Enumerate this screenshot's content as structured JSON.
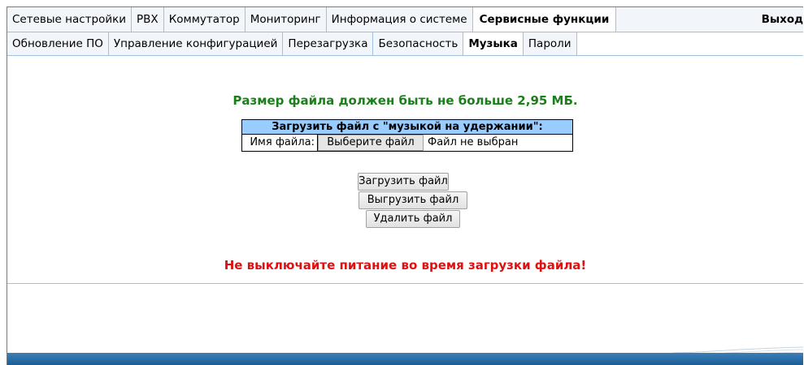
{
  "top_tabs": [
    {
      "label": "Сетевые настройки"
    },
    {
      "label": "PBX"
    },
    {
      "label": "Коммутатор"
    },
    {
      "label": "Мониторинг"
    },
    {
      "label": "Информация о системе"
    },
    {
      "label": "Сервисные функции",
      "active": true
    }
  ],
  "logout_label": "Выход",
  "sub_tabs": [
    {
      "label": "Обновление ПО"
    },
    {
      "label": "Управление конфигурацией"
    },
    {
      "label": "Перезагрузка"
    },
    {
      "label": "Безопасность"
    },
    {
      "label": "Музыка",
      "active": true
    },
    {
      "label": "Пароли"
    }
  ],
  "main": {
    "size_note": "Размер файла должен быть не больше 2,95 МБ.",
    "upload_table": {
      "header": "Загрузить файл с \"музыкой на удержании\":",
      "file_label": "Имя файла:",
      "choose_button": "Выберите файл",
      "no_file_text": "Файл не выбран"
    },
    "upload_button": "Загрузить файл",
    "download_button": "Выгрузить файл",
    "delete_button": "Удалить файл",
    "warning": "Не выключайте питание во время загрузки файла!"
  },
  "colors": {
    "note_green": "#1b7f1b",
    "warning_red": "#e01010",
    "table_header_blue": "#99ccff",
    "tab_border": "#9fc0df",
    "footer_blue": "#1d5d95"
  }
}
